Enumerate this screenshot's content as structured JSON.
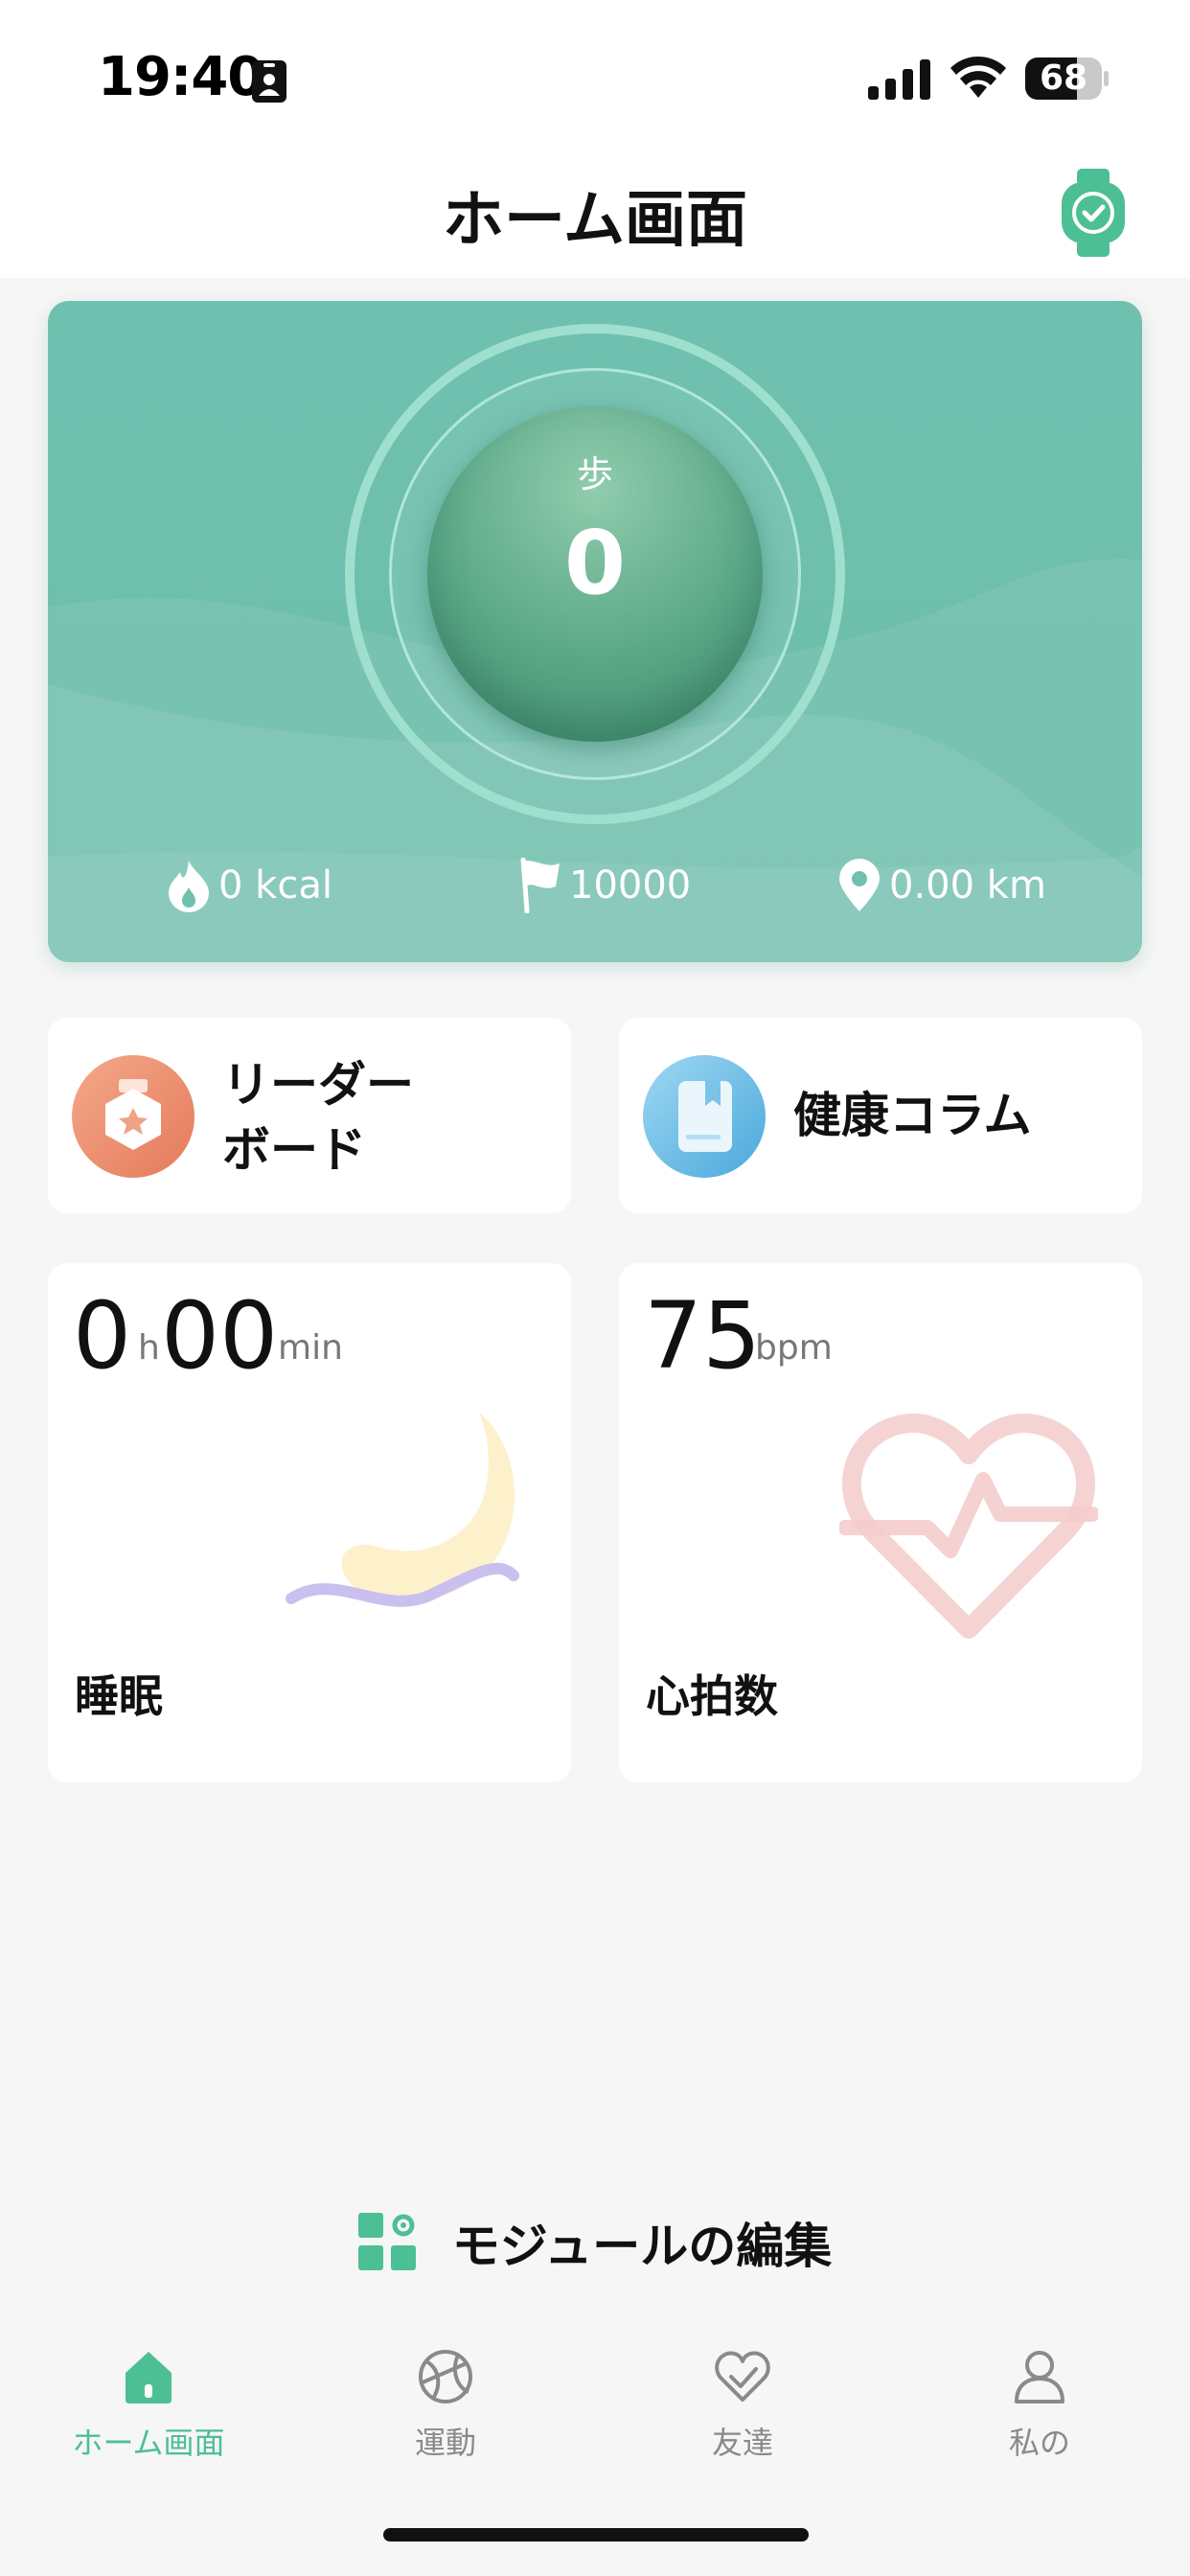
{
  "status_bar": {
    "time": "19:40",
    "battery": "68",
    "battery_level": 0.68
  },
  "header": {
    "title": "ホーム画面"
  },
  "steps": {
    "label": "歩",
    "value": "0",
    "calories": "0 kcal",
    "goal": "10000",
    "distance": "0.00 km"
  },
  "shortcuts": {
    "leaderboard": {
      "label_line1": "リーダー",
      "label_line2": "ボード"
    },
    "health_column": {
      "label": "健康コラム"
    }
  },
  "sleep": {
    "hours": "0",
    "hours_unit": "h",
    "minutes": "00",
    "minutes_unit": "min",
    "label": "睡眠"
  },
  "heart_rate": {
    "value": "75",
    "unit": "bpm",
    "label": "心拍数"
  },
  "edit_modules": {
    "label": "モジュールの編集"
  },
  "tabs": [
    {
      "label": "ホーム画面",
      "icon": "home-icon",
      "active": true
    },
    {
      "label": "運動",
      "icon": "basketball-icon",
      "active": false
    },
    {
      "label": "友達",
      "icon": "heart-icon",
      "active": false
    },
    {
      "label": "私の",
      "icon": "person-icon",
      "active": false
    }
  ],
  "colors": {
    "accent": "#4cbf95",
    "card": "#6fc0ae",
    "ring": "#9ee0cd"
  }
}
